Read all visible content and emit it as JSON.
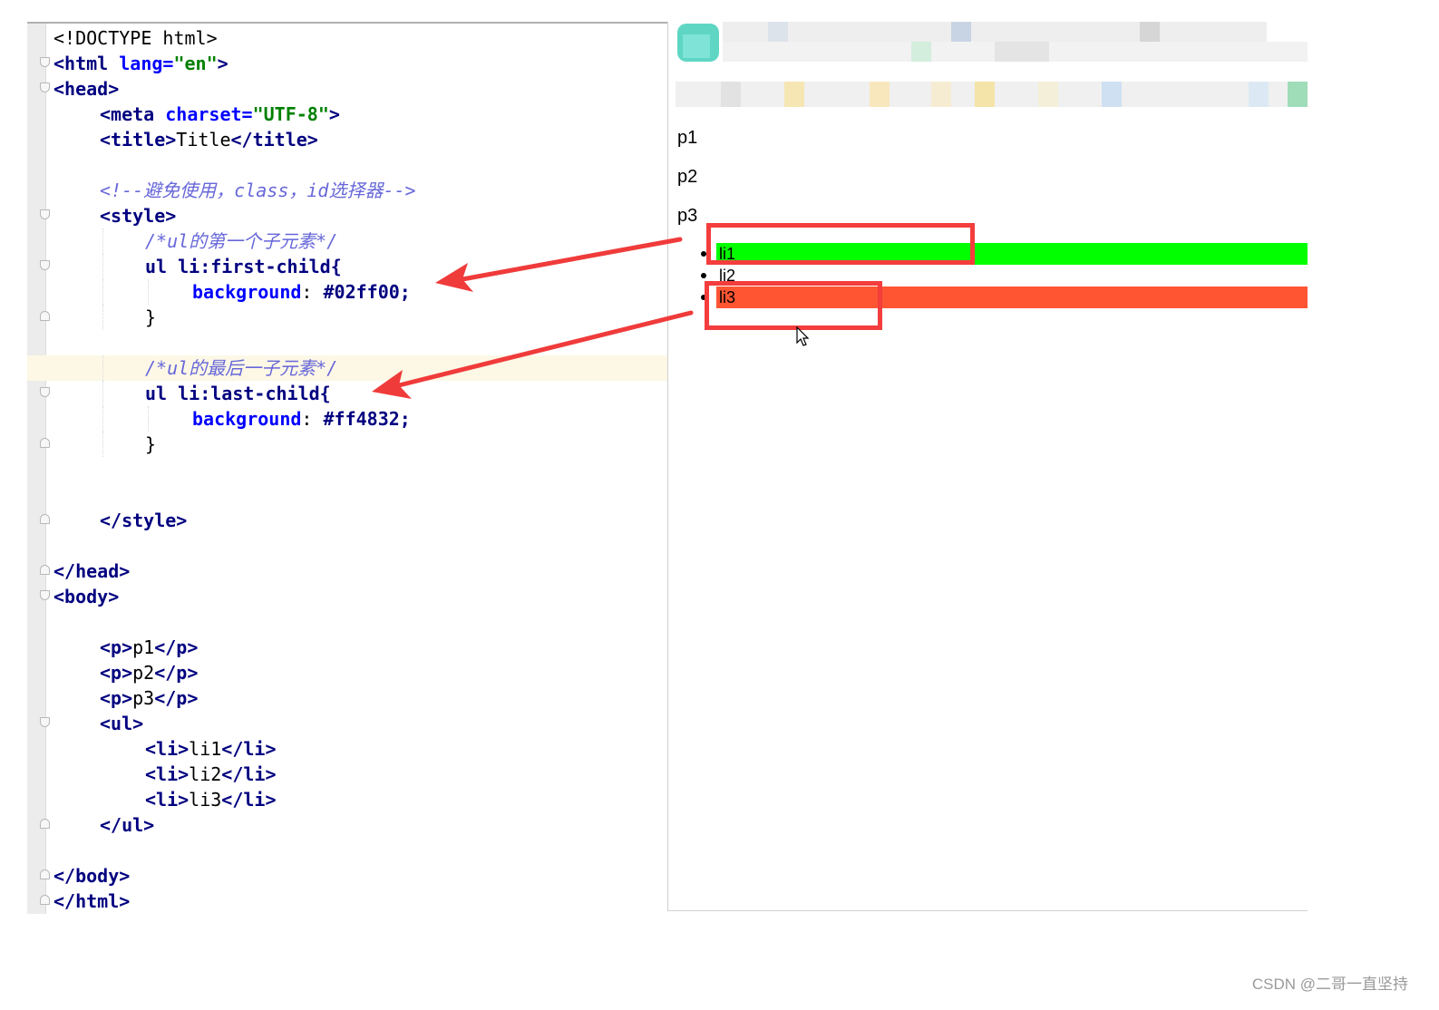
{
  "editor": {
    "lines": {
      "doctype": "<!DOCTYPE html>",
      "html_open_tag": "<html ",
      "html_lang_attr": "lang=",
      "html_lang_val": "\"en\"",
      "html_open_end": ">",
      "head_open": "<head>",
      "meta_tag": "<meta ",
      "meta_attr": "charset=",
      "meta_val": "\"UTF-8\"",
      "meta_end": ">",
      "title_open": "<title>",
      "title_text": "Title",
      "title_close": "</title>",
      "comment_avoid": "<!--避免使用，class，id选择器-->",
      "style_open": "<style>",
      "comment_first": "/*ul的第一个子元素*/",
      "sel_first": "ul li:first-child{",
      "prop_bg_1": "background",
      "colon_1": ": ",
      "val_first": "#02ff00;",
      "brace_close_1": "}",
      "comment_last": "/*ul的最后一子元素*/",
      "sel_last": "ul li:last-child{",
      "prop_bg_2": "background",
      "colon_2": ": ",
      "val_last": "#ff4832;",
      "brace_close_2": "}",
      "style_close": "</style>",
      "head_close": "</head>",
      "body_open": "<body>",
      "p1_open": "<p>",
      "p1_text": "p1",
      "p1_close": "</p>",
      "p2_open": "<p>",
      "p2_text": "p2",
      "p2_close": "</p>",
      "p3_open": "<p>",
      "p3_text": "p3",
      "p3_close": "</p>",
      "ul_open": "<ul>",
      "li1_open": "<li>",
      "li1_text": "li1",
      "li1_close": "</li>",
      "li2_open": "<li>",
      "li2_text": "li2",
      "li2_close": "</li>",
      "li3_open": "<li>",
      "li3_text": "li3",
      "li3_close": "</li>",
      "ul_close": "</ul>",
      "body_close": "</body>",
      "html_close": "</html>"
    }
  },
  "browser": {
    "paragraphs": [
      "p1",
      "p2",
      "p3"
    ],
    "list_items": [
      "li1",
      "li2",
      "li3"
    ],
    "first_child_color": "#02ff00",
    "last_child_color": "#ff4832"
  },
  "annotations": {
    "arrow_color": "#f03b3b",
    "box_color": "#f43d3d"
  },
  "watermark": "CSDN @二哥一直坚持"
}
